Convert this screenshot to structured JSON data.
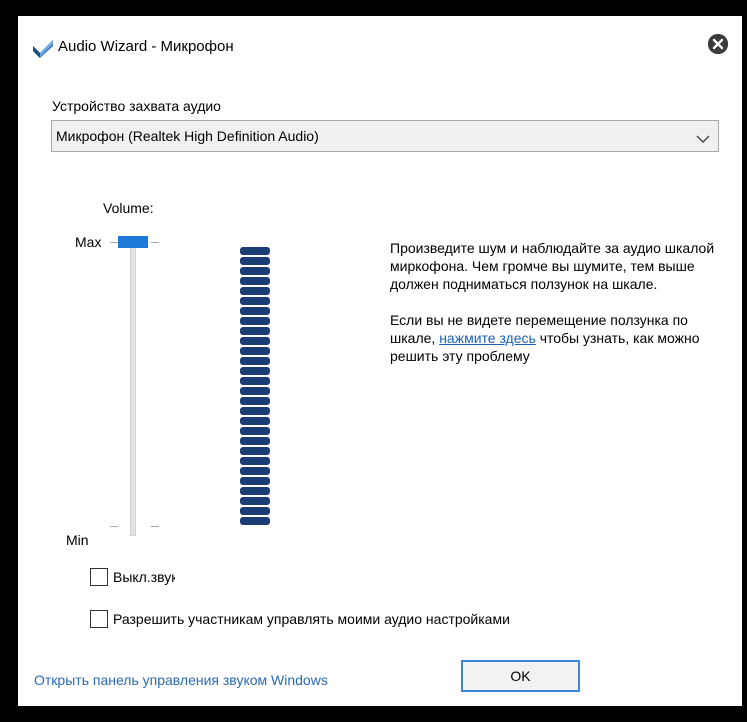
{
  "window": {
    "title": "Audio Wizard - Микрофон"
  },
  "device": {
    "label": "Устройство захвата аудио",
    "selected": "Микрофон (Realtek High Definition Audio)"
  },
  "volume": {
    "label": "Volume:",
    "max_label": "Max",
    "min_label": "Min",
    "level": 1.0
  },
  "meter": {
    "segments": 28
  },
  "instructions": {
    "paragraph1": "Произведите шум и наблюдайте за аудио шкалой миркофона. Чем громче вы шумите, тем выше должен подниматься ползунок на шкале.",
    "paragraph2_before": "Если вы не видете перемещение ползунка по шкале,",
    "link": "нажмите здесь",
    "paragraph2_after": "чтобы узнать, как можно решить эту проблему"
  },
  "options": {
    "mute_label": "Выкл.звук",
    "allow_label": "Разрешить участникам управлять моими аудио настройками",
    "mute_checked": false,
    "allow_checked": false
  },
  "footer": {
    "windows_link": "Открыть панель управления звуком Windows",
    "ok_label": "OK"
  },
  "colors": {
    "accent": "#1e78d7",
    "meter": "#1a3e74",
    "link": "#1a5fb4"
  }
}
